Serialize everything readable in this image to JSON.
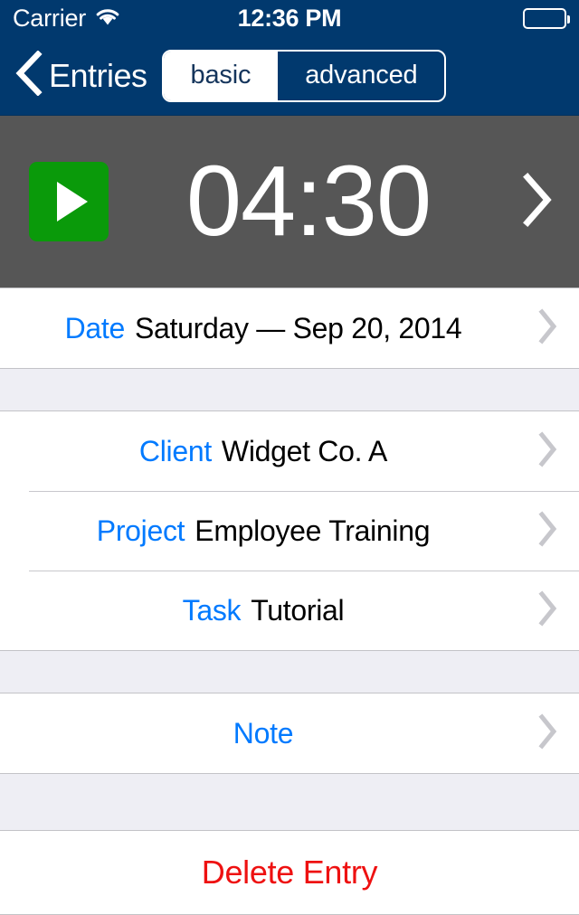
{
  "status_bar": {
    "carrier": "Carrier",
    "wifi_icon": "wifi-icon",
    "time": "12:36 PM",
    "battery_icon": "battery-icon"
  },
  "nav_bar": {
    "back_icon": "chevron-left-icon",
    "back_label": "Entries",
    "segmented_control": {
      "options": [
        {
          "label": "basic",
          "selected": true
        },
        {
          "label": "advanced",
          "selected": false
        }
      ]
    }
  },
  "timer": {
    "play_icon": "play-icon",
    "value": "04:30",
    "chevron_icon": "chevron-right-icon"
  },
  "sections": [
    {
      "rows": [
        {
          "label": "Date",
          "value": "Saturday — Sep 20, 2014",
          "chevron_icon": "chevron-right-icon"
        }
      ]
    },
    {
      "rows": [
        {
          "label": "Client",
          "value": "Widget Co. A",
          "chevron_icon": "chevron-right-icon"
        },
        {
          "label": "Project",
          "value": "Employee Training",
          "chevron_icon": "chevron-right-icon"
        },
        {
          "label": "Task",
          "value": "Tutorial",
          "chevron_icon": "chevron-right-icon"
        }
      ]
    },
    {
      "rows": [
        {
          "label": "Note",
          "value": "",
          "chevron_icon": "chevron-right-icon"
        }
      ]
    }
  ],
  "delete_button": {
    "label": "Delete Entry"
  },
  "colors": {
    "nav_blue": "#01396e",
    "timer_gray": "#565656",
    "play_green": "#0a9a0a",
    "label_blue": "#007aff",
    "delete_red": "#ee1111",
    "section_gap": "#eeeef4",
    "separator": "#c8c7cc"
  }
}
